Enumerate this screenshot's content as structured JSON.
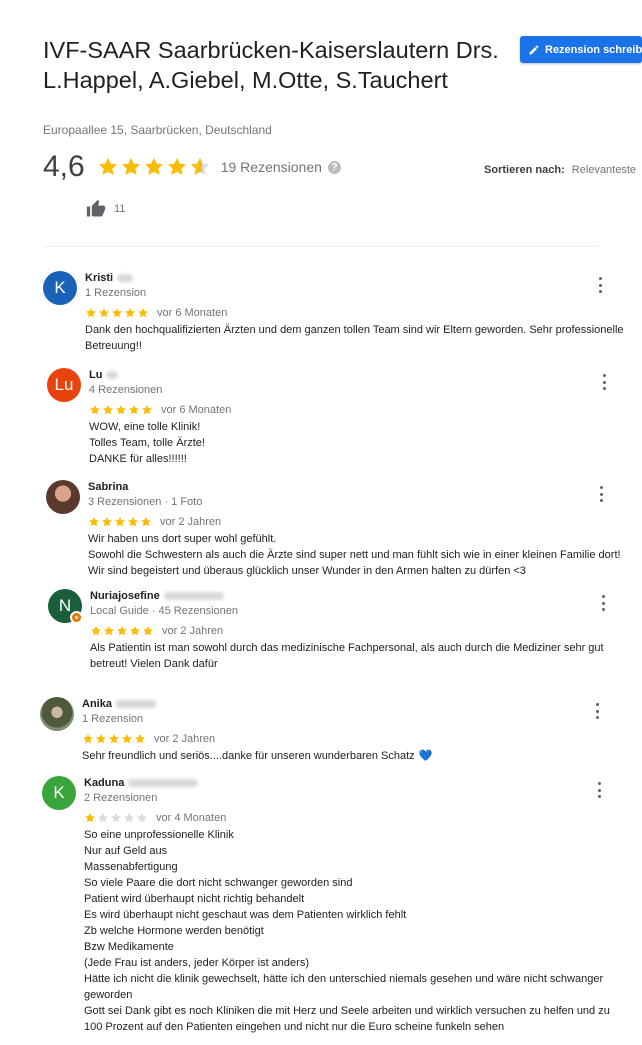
{
  "header": {
    "title": "IVF-SAAR Saarbrücken-Kaiserslautern Drs. L.Happel, A.Giebel, M.Otte, S.Tauchert",
    "address": "Europaallee 15, Saarbrücken, Deutschland",
    "write_review_label": "Rezension schreiben",
    "rating": "4,6",
    "rating_value": 4.6,
    "review_count": "19 Rezensionen",
    "help_glyph": "?",
    "sort_label": "Sortieren nach:",
    "sort_value": "Relevanteste",
    "likes": "11"
  },
  "colors": {
    "star_filled": "#fbbc04",
    "star_empty": "#dadce0",
    "accent": "#1a73e8"
  },
  "reviews": [
    {
      "initial": "K",
      "avatar_color": "#1a62b8",
      "avatar_type": "letter",
      "name": "Kristi",
      "meta": "1 Rezension",
      "stars": 5,
      "date": "vor 6 Monaten",
      "text": "Dank den hochqualifizierten Ärzten und dem ganzen tollen Team sind wir Eltern geworden. Sehr professionelle Betreuung!!"
    },
    {
      "initial": "Lu",
      "avatar_color": "#e8430c",
      "avatar_type": "letter",
      "name": "Lu",
      "meta": "4 Rezensionen",
      "stars": 5,
      "date": "vor 6 Monaten",
      "text": "WOW, eine tolle Klinik!\nTolles Team, tolle Ärzte!\nDANKE für alles!!!!!!"
    },
    {
      "initial": "",
      "avatar_color": "#6d4c41",
      "avatar_type": "photo",
      "name": "Sabrina",
      "meta": "3 Rezensionen · 1 Foto",
      "stars": 5,
      "date": "vor 2 Jahren",
      "text": "Wir haben uns dort super wohl gefühlt.\nSowohl die Schwestern als auch die Ärzte sind super nett und man fühlt sich wie in einer kleinen Familie dort! Wir sind begeistert und überaus glücklich unser Wunder in den Armen halten zu dürfen <3"
    },
    {
      "initial": "N",
      "avatar_color": "#1b5e3b",
      "avatar_type": "letter",
      "name": "Nuriajosefine",
      "meta": "Local Guide · 45 Rezensionen",
      "stars": 5,
      "date": "vor 2 Jahren",
      "text": "Als Patientin ist man sowohl durch das medizinische Fachpersonal, als auch durch die Mediziner sehr gut betreut! Vielen Dank dafür"
    },
    {
      "initial": "",
      "avatar_color": "#5d6b4f",
      "avatar_type": "photo2",
      "name": "Anika",
      "meta": "1 Rezension",
      "stars": 5,
      "date": "vor 2 Jahren",
      "text": "Sehr freundlich und seriös....danke für unseren wunderbaren Schatz",
      "emoji": "💙"
    },
    {
      "initial": "K",
      "avatar_color": "#3aa53a",
      "avatar_type": "letter",
      "name": "Kaduna",
      "meta": "2 Rezensionen",
      "stars": 1,
      "date": "vor 4 Monaten",
      "text": "So eine unprofessionelle Klinik\nNur auf Geld aus\nMassenabfertigung\nSo viele Paare die dort nicht schwanger geworden sind\nPatient wird überhaupt nicht richtig behandelt\nEs wird überhaupt nicht geschaut was dem Patienten wirklich fehlt\nZb welche Hormone werden benötigt\nBzw Medikamente\n(Jede Frau ist anders,  jeder Körper ist anders)\nHätte ich nicht die klinik gewechselt, hätte ich den unterschied niemals gesehen und wäre nicht schwanger geworden\nGott sei Dank gibt es noch Kliniken die mit Herz und Seele arbeiten und wirklich versuchen zu helfen und zu 100 Prozent auf den Patienten eingehen und nicht nur die Euro scheine funkeln sehen"
    }
  ]
}
